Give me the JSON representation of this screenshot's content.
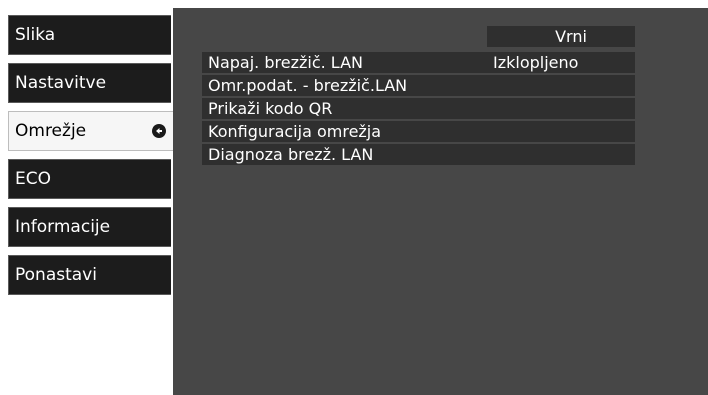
{
  "sidebar": {
    "items": [
      {
        "label": "Slika"
      },
      {
        "label": "Nastavitve"
      },
      {
        "label": "Omrežje",
        "selected": true
      },
      {
        "label": "ECO"
      },
      {
        "label": "Informacije"
      },
      {
        "label": "Ponastavi"
      }
    ],
    "selected_icon": "selected-indicator-icon"
  },
  "menu": {
    "back_label": "Vrni",
    "items": [
      {
        "label": "Napaj. brezžič. LAN",
        "value": "Izklopljeno"
      },
      {
        "label": "Omr.podat. - brezžič.LAN"
      },
      {
        "label": "Prikaži kodo QR"
      },
      {
        "label": "Konfiguracija omrežja"
      },
      {
        "label": "Diagnoza brezž. LAN"
      }
    ]
  },
  "colors": {
    "panel": "#474747",
    "tab": "#1c1c1c",
    "tab_selected": "#f6f6f6",
    "row": "#2f2f2f"
  }
}
